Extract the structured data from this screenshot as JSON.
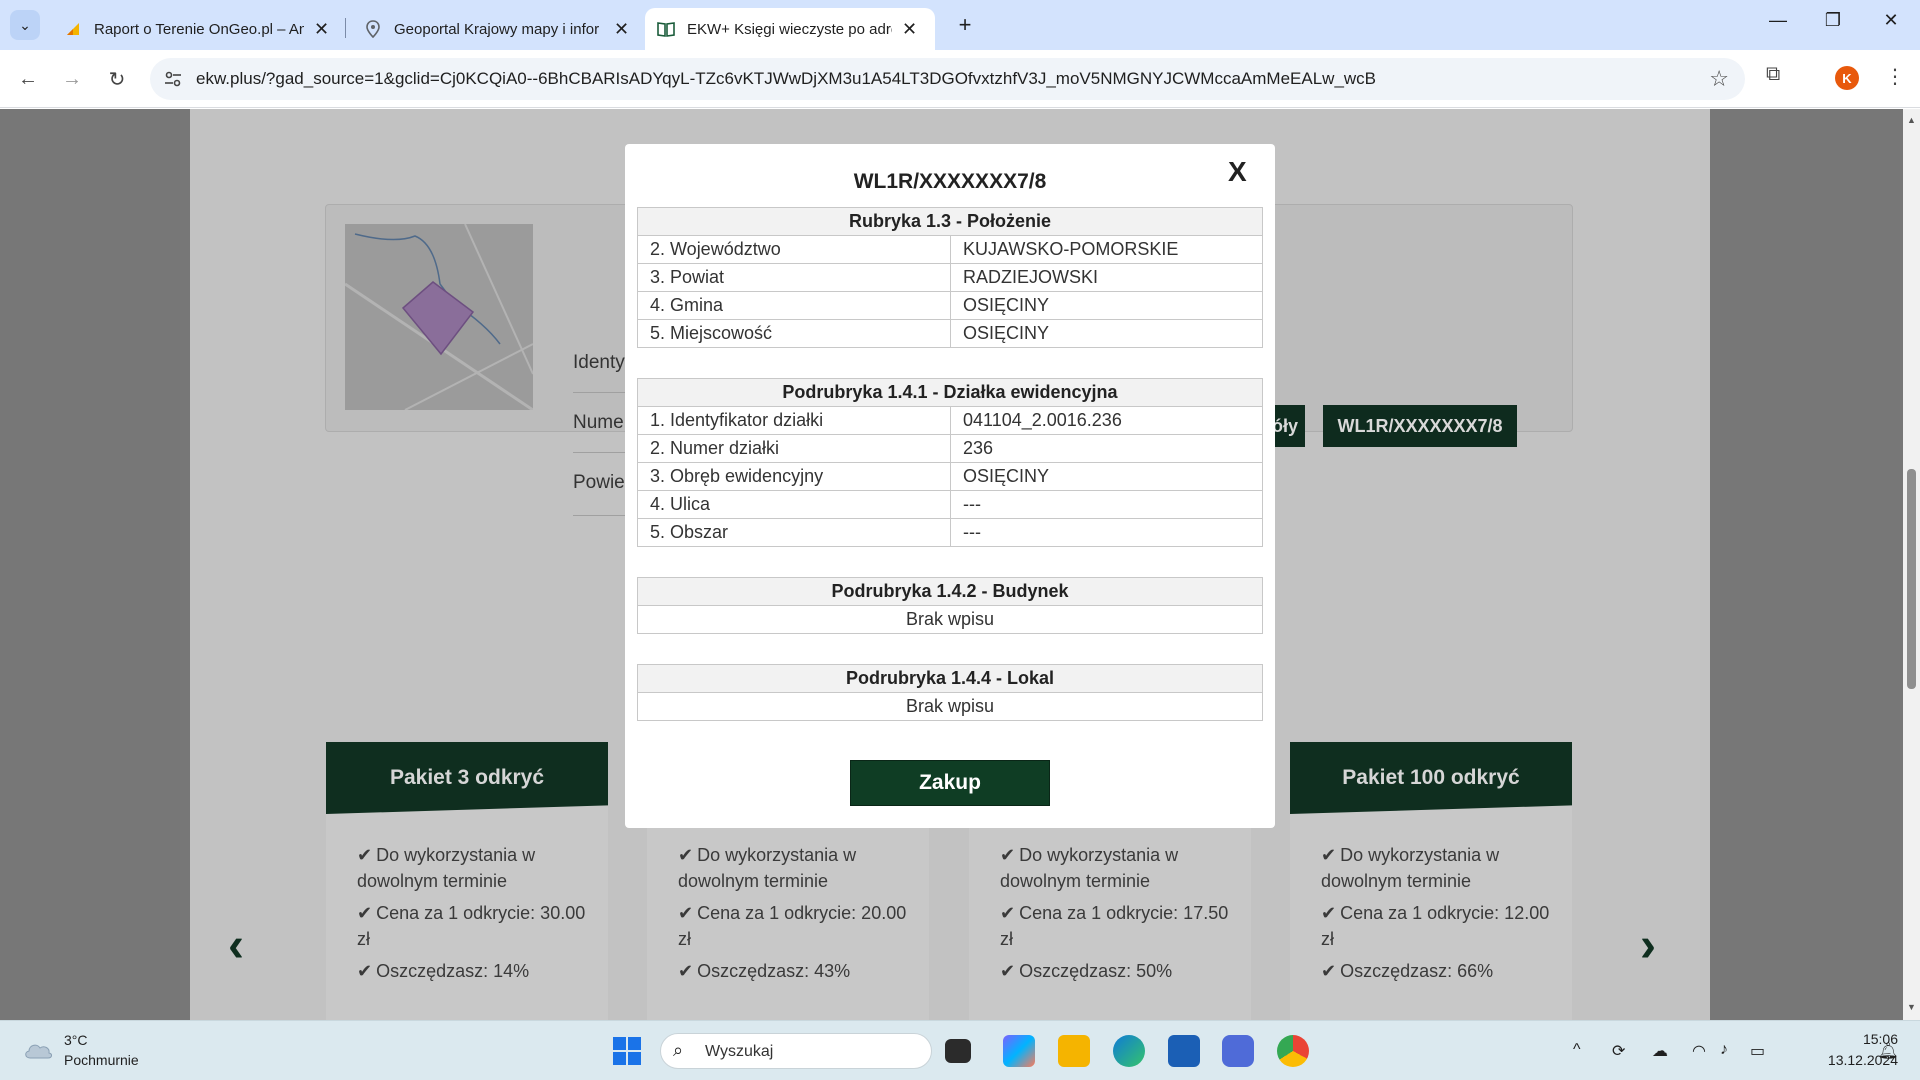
{
  "browser": {
    "tabs": [
      {
        "title": "Raport o Terenie OnGeo.pl – An",
        "icon": "ongeo-icon"
      },
      {
        "title": "Geoportal Krajowy mapy i infor",
        "icon": "map-pin-icon"
      },
      {
        "title": "EKW+ Księgi wieczyste po adre",
        "icon": "book-icon",
        "active": true
      }
    ],
    "url": "ekw.plus/?gad_source=1&gclid=Cj0KCQiA0--6BhCBARIsADYqyL-TZc6vKTJWwDjXM3u1A54LT3DGOfvxtzhfV3J_moV5NMGNYJCWMccaAmMeEALw_wcB",
    "avatar_letter": "K"
  },
  "background": {
    "labels": [
      "Identy",
      "Nume",
      "Powie"
    ],
    "button_partial": "óły",
    "kw_button": "WL1R/XXXXXXX7/8",
    "packages": [
      {
        "title": "Pakiet 3 odkryć",
        "item1": "Do wykorzystania w dowolnym terminie",
        "item2": "Cena za 1 odkrycie: 30.00 zł",
        "item3": "Oszczędzasz: 14%"
      },
      {
        "title": "",
        "item1": "Do wykorzystania w dowolnym terminie",
        "item2": "Cena za 1 odkrycie: 20.00 zł",
        "item3": "Oszczędzasz: 43%"
      },
      {
        "title": "",
        "item1": "Do wykorzystania w dowolnym terminie",
        "item2": "Cena za 1 odkrycie: 17.50 zł",
        "item3": "Oszczędzasz: 50%"
      },
      {
        "title": "Pakiet 100 odkryć",
        "item1": "Do wykorzystania w dowolnym terminie",
        "item2": "Cena za 1 odkrycie: 12.00 zł",
        "item3": "Oszczędzasz: 66%"
      }
    ]
  },
  "modal": {
    "title": "WL1R/XXXXXXX7/8",
    "close": "X",
    "polozenie": {
      "header": "Rubryka 1.3 - Położenie",
      "rows": [
        {
          "label": "2. Województwo",
          "value": "KUJAWSKO-POMORSKIE"
        },
        {
          "label": "3. Powiat",
          "value": "RADZIEJOWSKI"
        },
        {
          "label": "4. Gmina",
          "value": "OSIĘCINY"
        },
        {
          "label": "5. Miejscowość",
          "value": "OSIĘCINY"
        }
      ]
    },
    "dzialka": {
      "header": "Podrubryka 1.4.1 - Działka ewidencyjna",
      "rows": [
        {
          "label": "1. Identyfikator działki",
          "value": "041104_2.0016.236"
        },
        {
          "label": "2. Numer działki",
          "value": "236"
        },
        {
          "label": "3. Obręb ewidencyjny",
          "value": "OSIĘCINY"
        },
        {
          "label": "4. Ulica",
          "value": "---"
        },
        {
          "label": "5. Obszar",
          "value": "---"
        }
      ]
    },
    "budynek": {
      "header": "Podrubryka 1.4.2 - Budynek",
      "value": "Brak wpisu"
    },
    "lokal": {
      "header": "Podrubryka 1.4.4 - Lokal",
      "value": "Brak wpisu"
    },
    "buy_button": "Zakup"
  },
  "taskbar": {
    "weather_temp": "3°C",
    "weather_desc": "Pochmurnie",
    "search_placeholder": "Wyszukaj",
    "time": "15:06",
    "date": "13.12.2024"
  }
}
